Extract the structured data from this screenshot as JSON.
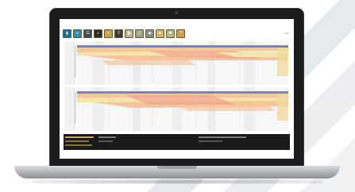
{
  "page": {
    "background": "#ffffff"
  },
  "device": {
    "type": "laptop",
    "bezel_color": "#1b1c1e"
  },
  "app": {
    "toolbar": {
      "buttons": [
        {
          "icon": "bar-chart-icon",
          "color": "#1e6f8a"
        },
        {
          "icon": "sort-icon",
          "color": "#2a8fa8"
        },
        {
          "icon": "list-icon",
          "color": "#4a4a4a"
        },
        {
          "icon": "search-icon",
          "color": "#2b2b2b"
        },
        {
          "icon": "waveform-icon",
          "color": "#caa24a"
        },
        {
          "icon": "filter-icon",
          "color": "#3c3c3c"
        },
        {
          "icon": "grid-icon",
          "color": "#b7b08a"
        },
        {
          "icon": "layers-icon",
          "color": "#9aa089"
        },
        {
          "icon": "tag-icon",
          "color": "#8c8f7a"
        },
        {
          "icon": "star-icon",
          "color": "#d6b46a"
        },
        {
          "icon": "settings-icon",
          "color": "#b8b47e"
        },
        {
          "icon": "help-icon",
          "color": "#cf9e46"
        }
      ]
    },
    "track_colors": {
      "header_blue": "#6f88c8",
      "band_orange": "#f6c59c",
      "band_yellow": "#f3e7a8",
      "band_red": "#f0a38e"
    }
  }
}
